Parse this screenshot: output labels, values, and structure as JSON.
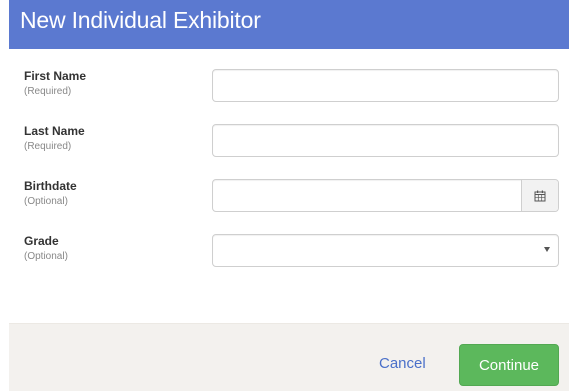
{
  "modal": {
    "title": "New Individual Exhibitor"
  },
  "fields": [
    {
      "label": "First Name",
      "requirement": "(Required)",
      "value": "",
      "placeholder": ""
    },
    {
      "label": "Last Name",
      "requirement": "(Required)",
      "value": "",
      "placeholder": ""
    },
    {
      "label": "Birthdate",
      "requirement": "(Optional)",
      "value": "",
      "placeholder": "",
      "icon": "calendar-icon"
    },
    {
      "label": "Grade",
      "requirement": "(Optional)",
      "selected": "",
      "icon": "caret-down-icon"
    }
  ],
  "footer": {
    "cancel_label": "Cancel",
    "continue_label": "Continue"
  },
  "colors": {
    "header": "#5b79d0",
    "continue": "#5cb85c",
    "link": "#4a70c9",
    "footer_bg": "#f3f1ee"
  }
}
